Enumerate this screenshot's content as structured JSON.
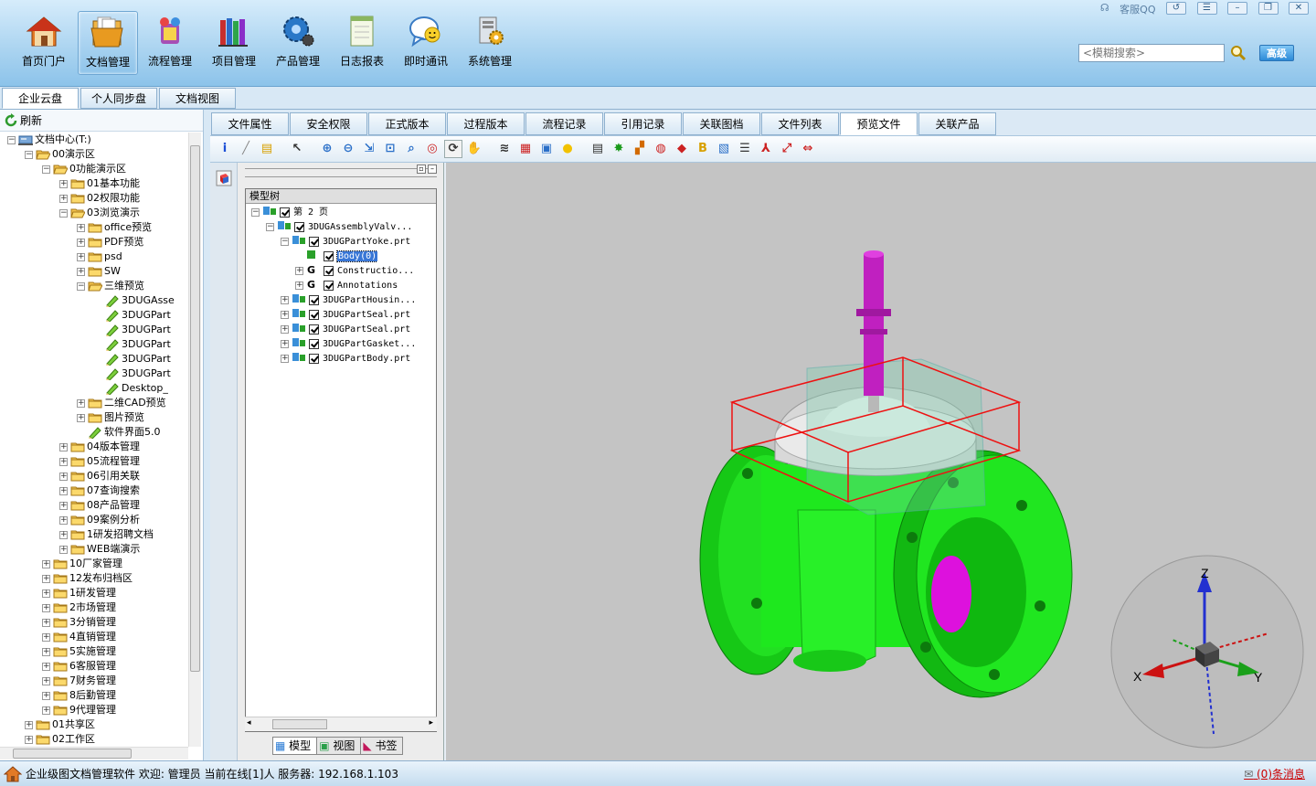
{
  "header": {
    "nav": [
      {
        "label": "首页门户",
        "icon": "home-icon"
      },
      {
        "label": "文档管理",
        "icon": "folder-docs-icon",
        "active": true
      },
      {
        "label": "流程管理",
        "icon": "workflow-icon"
      },
      {
        "label": "项目管理",
        "icon": "books-icon"
      },
      {
        "label": "产品管理",
        "icon": "gear-product-icon"
      },
      {
        "label": "日志报表",
        "icon": "notepad-icon"
      },
      {
        "label": "即时通讯",
        "icon": "chat-icon"
      },
      {
        "label": "系统管理",
        "icon": "system-icon"
      }
    ],
    "service": "客服QQ",
    "search_placeholder": "<模糊搜索>",
    "advanced_label": "高级"
  },
  "subtabs": [
    "企业云盘",
    "个人同步盘",
    "文档视图"
  ],
  "left": {
    "refresh_label": "刷新",
    "tree": [
      {
        "label": "文档中心(T:)",
        "level": 0,
        "toggle": "-",
        "icon": "drive"
      },
      {
        "label": "00演示区",
        "level": 1,
        "toggle": "-",
        "icon": "folder-open"
      },
      {
        "label": "0功能演示区",
        "level": 2,
        "toggle": "-",
        "icon": "folder-open"
      },
      {
        "label": "01基本功能",
        "level": 3,
        "toggle": "+",
        "icon": "folder"
      },
      {
        "label": "02权限功能",
        "level": 3,
        "toggle": "+",
        "icon": "folder"
      },
      {
        "label": "03浏览演示",
        "level": 3,
        "toggle": "-",
        "icon": "folder-open"
      },
      {
        "label": "office预览",
        "level": 4,
        "toggle": "+",
        "icon": "folder"
      },
      {
        "label": "PDF预览",
        "level": 4,
        "toggle": "+",
        "icon": "folder"
      },
      {
        "label": "psd",
        "level": 4,
        "toggle": "+",
        "icon": "folder"
      },
      {
        "label": "SW",
        "level": 4,
        "toggle": "+",
        "icon": "folder"
      },
      {
        "label": "三维预览",
        "level": 4,
        "toggle": "-",
        "icon": "folder-open"
      },
      {
        "label": "3DUGAsse",
        "level": 5,
        "toggle": "",
        "icon": "file"
      },
      {
        "label": "3DUGPart",
        "level": 5,
        "toggle": "",
        "icon": "file"
      },
      {
        "label": "3DUGPart",
        "level": 5,
        "toggle": "",
        "icon": "file"
      },
      {
        "label": "3DUGPart",
        "level": 5,
        "toggle": "",
        "icon": "file"
      },
      {
        "label": "3DUGPart",
        "level": 5,
        "toggle": "",
        "icon": "file"
      },
      {
        "label": "3DUGPart",
        "level": 5,
        "toggle": "",
        "icon": "file"
      },
      {
        "label": "Desktop_",
        "level": 5,
        "toggle": "",
        "icon": "file"
      },
      {
        "label": "二维CAD预览",
        "level": 4,
        "toggle": "+",
        "icon": "folder"
      },
      {
        "label": "图片预览",
        "level": 4,
        "toggle": "+",
        "icon": "folder"
      },
      {
        "label": "软件界面5.0",
        "level": 4,
        "toggle": "",
        "icon": "file"
      },
      {
        "label": "04版本管理",
        "level": 3,
        "toggle": "+",
        "icon": "folder"
      },
      {
        "label": "05流程管理",
        "level": 3,
        "toggle": "+",
        "icon": "folder"
      },
      {
        "label": "06引用关联",
        "level": 3,
        "toggle": "+",
        "icon": "folder"
      },
      {
        "label": "07查询搜索",
        "level": 3,
        "toggle": "+",
        "icon": "folder"
      },
      {
        "label": "08产品管理",
        "level": 3,
        "toggle": "+",
        "icon": "folder"
      },
      {
        "label": "09案例分析",
        "level": 3,
        "toggle": "+",
        "icon": "folder"
      },
      {
        "label": "1研发招聘文档",
        "level": 3,
        "toggle": "+",
        "icon": "folder"
      },
      {
        "label": "WEB端演示",
        "level": 3,
        "toggle": "+",
        "icon": "folder"
      },
      {
        "label": "10厂家管理",
        "level": 2,
        "toggle": "+",
        "icon": "folder"
      },
      {
        "label": "12发布归档区",
        "level": 2,
        "toggle": "+",
        "icon": "folder"
      },
      {
        "label": "1研发管理",
        "level": 2,
        "toggle": "+",
        "icon": "folder"
      },
      {
        "label": "2市场管理",
        "level": 2,
        "toggle": "+",
        "icon": "folder"
      },
      {
        "label": "3分销管理",
        "level": 2,
        "toggle": "+",
        "icon": "folder"
      },
      {
        "label": "4直销管理",
        "level": 2,
        "toggle": "+",
        "icon": "folder"
      },
      {
        "label": "5实施管理",
        "level": 2,
        "toggle": "+",
        "icon": "folder"
      },
      {
        "label": "6客服管理",
        "level": 2,
        "toggle": "+",
        "icon": "folder"
      },
      {
        "label": "7财务管理",
        "level": 2,
        "toggle": "+",
        "icon": "folder"
      },
      {
        "label": "8后勤管理",
        "level": 2,
        "toggle": "+",
        "icon": "folder"
      },
      {
        "label": "9代理管理",
        "level": 2,
        "toggle": "+",
        "icon": "folder"
      },
      {
        "label": "01共享区",
        "level": 1,
        "toggle": "+",
        "icon": "folder"
      },
      {
        "label": "02工作区",
        "level": 1,
        "toggle": "+",
        "icon": "folder"
      }
    ]
  },
  "doc_tabs": [
    {
      "label": "文件属性"
    },
    {
      "label": "安全权限"
    },
    {
      "label": "正式版本"
    },
    {
      "label": "过程版本"
    },
    {
      "label": "流程记录"
    },
    {
      "label": "引用记录"
    },
    {
      "label": "关联图档"
    },
    {
      "label": "文件列表"
    },
    {
      "label": "预览文件",
      "active": true
    },
    {
      "label": "关联产品"
    }
  ],
  "model": {
    "header": "模型树",
    "nodes": [
      {
        "label": "第 2 页",
        "level": 0,
        "toggle": "-",
        "sel": false
      },
      {
        "label": "3DUGAssemblyValv...",
        "level": 1,
        "toggle": "-",
        "sel": false
      },
      {
        "label": "3DUGPartYoke.prt",
        "level": 2,
        "toggle": "-",
        "sel": false
      },
      {
        "label": "Body(0)",
        "level": 3,
        "toggle": "",
        "sel": true
      },
      {
        "label": "Constructio...",
        "level": 3,
        "toggle": "+",
        "sel": false,
        "g": true
      },
      {
        "label": "Annotations",
        "level": 3,
        "toggle": "+",
        "sel": false,
        "g": true
      },
      {
        "label": "3DUGPartHousin...",
        "level": 2,
        "toggle": "+",
        "sel": false
      },
      {
        "label": "3DUGPartSeal.prt",
        "level": 2,
        "toggle": "+",
        "sel": false
      },
      {
        "label": "3DUGPartSeal.prt",
        "level": 2,
        "toggle": "+",
        "sel": false
      },
      {
        "label": "3DUGPartGasket...",
        "level": 2,
        "toggle": "+",
        "sel": false
      },
      {
        "label": "3DUGPartBody.prt",
        "level": 2,
        "toggle": "+",
        "sel": false
      }
    ],
    "tabs": [
      "模型",
      "视图",
      "书签"
    ]
  },
  "axes": {
    "x": "X",
    "y": "Y",
    "z": "Z"
  },
  "status": {
    "text": "企业级图文档管理软件 欢迎: 管理员 当前在线[1]人 服务器: 192.168.1.103",
    "messages": "(0)条消息"
  },
  "colors": {
    "valve_body": "#1ee81e",
    "stem": "#cc22cc",
    "bbox": "#ee1111"
  }
}
